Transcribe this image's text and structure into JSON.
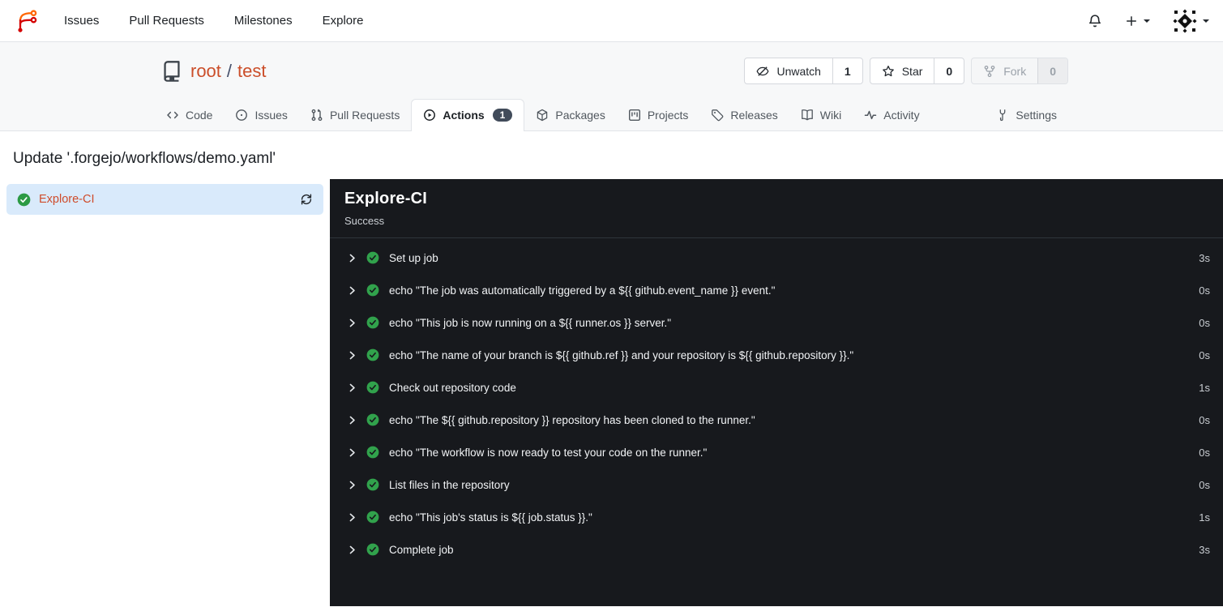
{
  "topnav": {
    "items": [
      {
        "label": "Issues"
      },
      {
        "label": "Pull Requests"
      },
      {
        "label": "Milestones"
      },
      {
        "label": "Explore"
      }
    ]
  },
  "repo": {
    "owner": "root",
    "separator": "/",
    "name": "test",
    "buttons": [
      {
        "label": "Unwatch",
        "count": "1"
      },
      {
        "label": "Star",
        "count": "0"
      },
      {
        "label": "Fork",
        "count": "0",
        "disabled": true
      }
    ]
  },
  "tabs": [
    {
      "label": "Code"
    },
    {
      "label": "Issues"
    },
    {
      "label": "Pull Requests"
    },
    {
      "label": "Actions",
      "badge": "1",
      "active": true
    },
    {
      "label": "Packages"
    },
    {
      "label": "Projects"
    },
    {
      "label": "Releases"
    },
    {
      "label": "Wiki"
    },
    {
      "label": "Activity"
    },
    {
      "label": "Settings"
    }
  ],
  "page": {
    "title": "Update '.forgejo/workflows/demo.yaml'"
  },
  "run": {
    "jobs": [
      {
        "name": "Explore-CI",
        "status": "success",
        "selected": true
      }
    ],
    "panel": {
      "title": "Explore-CI",
      "status": "Success"
    },
    "steps": [
      {
        "name": "Set up job",
        "duration": "3s"
      },
      {
        "name": "echo \"The job was automatically triggered by a ${{ github.event_name }} event.\"",
        "duration": "0s"
      },
      {
        "name": "echo \"This job is now running on a ${{ runner.os }} server.\"",
        "duration": "0s"
      },
      {
        "name": "echo \"The name of your branch is ${{ github.ref }} and your repository is ${{ github.repository }}.\"",
        "duration": "0s"
      },
      {
        "name": "Check out repository code",
        "duration": "1s"
      },
      {
        "name": "echo \"The ${{ github.repository }} repository has been cloned to the runner.\"",
        "duration": "0s"
      },
      {
        "name": "echo \"The workflow is now ready to test your code on the runner.\"",
        "duration": "0s"
      },
      {
        "name": "List files in the repository",
        "duration": "0s"
      },
      {
        "name": "echo \"This job's status is ${{ job.status }}.\"",
        "duration": "1s"
      },
      {
        "name": "Complete job",
        "duration": "3s"
      }
    ]
  },
  "colors": {
    "primary_link": "#cb4e2a",
    "success_green": "#2da44e",
    "panel_bg": "#17191d",
    "selected_job_bg": "#d9eafb",
    "badge_bg": "#414b5a",
    "logo_orange": "#ff6600",
    "logo_red": "#d40000"
  }
}
